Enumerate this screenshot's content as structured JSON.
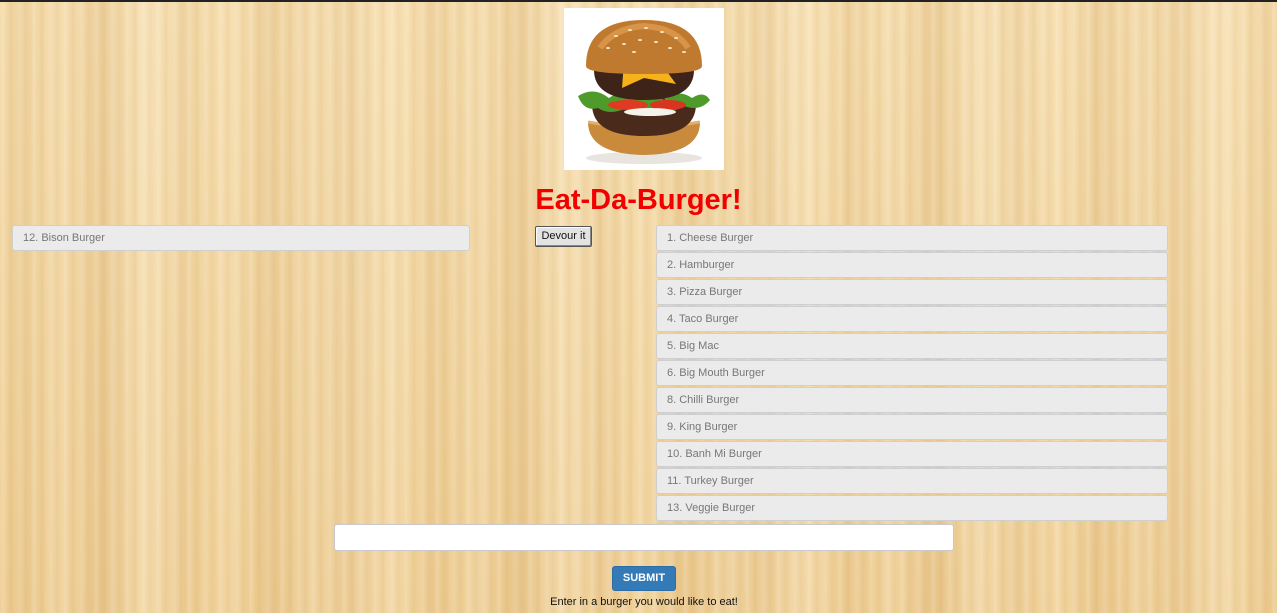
{
  "app": {
    "title": "Eat-Da-Burger!",
    "logo_icon": "burger-image"
  },
  "devoured": {
    "items": [
      "12. Bison Burger"
    ]
  },
  "devour_button_label": "Devour it",
  "menu": {
    "items": [
      "1. Cheese Burger",
      "2. Hamburger",
      "3. Pizza Burger",
      "4. Taco Burger",
      "5. Big Mac",
      "6. Big Mouth Burger",
      "8. Chilli Burger",
      "9. King Burger",
      "10. Banh Mi Burger",
      "11. Turkey Burger",
      "13. Veggie Burger"
    ]
  },
  "form": {
    "input_value": "",
    "submit_label": "SUBMIT",
    "help_text": "Enter in a burger you would like to eat!"
  },
  "colors": {
    "title": "#f20000",
    "submit": "#337ab7",
    "item_bg": "#ebebeb"
  }
}
